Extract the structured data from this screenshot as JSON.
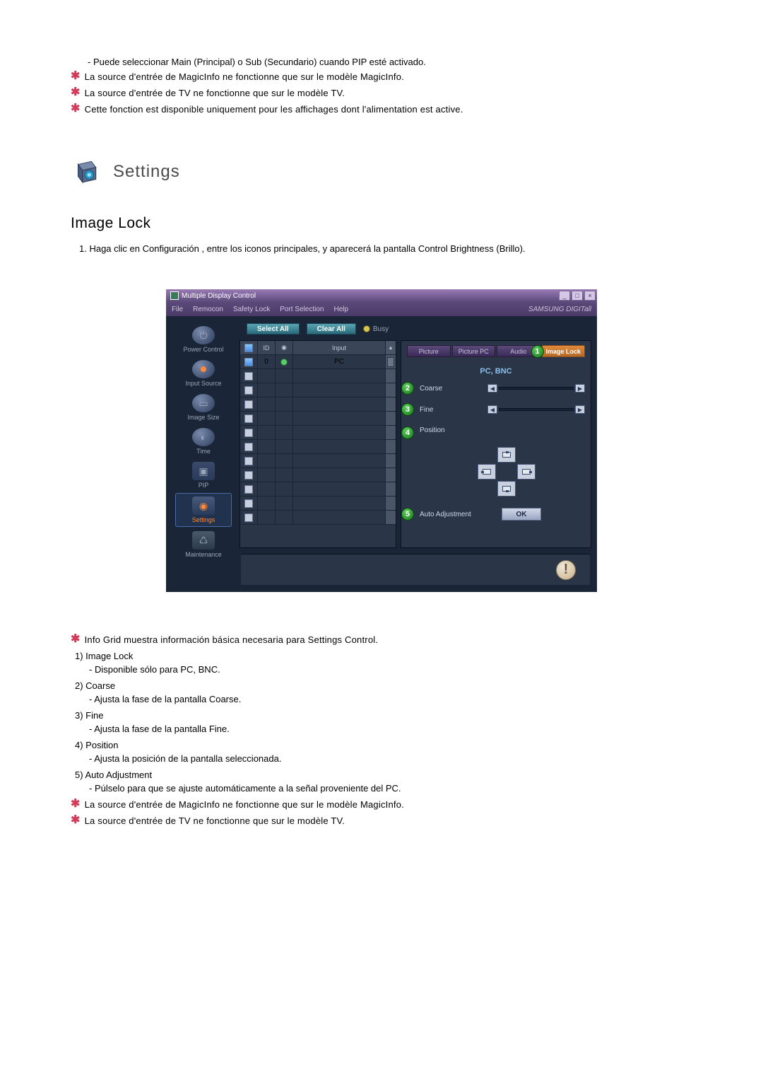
{
  "intro": {
    "dash_line": "- Puede seleccionar Main (Principal) o Sub (Secundario) cuando PIP esté activado.",
    "star1": "La source d'entrée de MagicInfo ne fonctionne que sur le modèle MagicInfo.",
    "star2": "La source d'entrée de TV ne fonctionne que sur le modèle TV.",
    "star3": "Cette fonction est disponible uniquement pour les affichages dont l'alimentation est active."
  },
  "section": {
    "title": "Settings",
    "subtitle": "Image Lock",
    "ol1": "1.  Haga clic en Configuración , entre los iconos principales, y aparecerá la pantalla Control Brightness (Brillo)."
  },
  "app": {
    "window_title": "Multiple Display Control",
    "menu": {
      "file": "File",
      "remocon": "Remocon",
      "safety": "Safety Lock",
      "port": "Port Selection",
      "help": "Help"
    },
    "brand": "SAMSUNG DIGITall",
    "win_buttons": {
      "min": "_",
      "max": "□",
      "close": "×"
    },
    "toolbar": {
      "select_all": "Select All",
      "clear_all": "Clear All",
      "busy": "Busy"
    },
    "sidebar": [
      {
        "label": "Power Control"
      },
      {
        "label": "Input Source"
      },
      {
        "label": "Image Size"
      },
      {
        "label": "Time"
      },
      {
        "label": "PIP"
      },
      {
        "label": "Settings"
      },
      {
        "label": "Maintenance"
      }
    ],
    "grid": {
      "h1": "☑",
      "h2": "ID",
      "h3": "●",
      "h4": "Input",
      "row1": {
        "id": "0",
        "input": "PC"
      }
    },
    "panel": {
      "tabs": {
        "picture": "Picture",
        "picture_pc": "Picture PC",
        "audio": "Audio",
        "image_lock": "Image Lock"
      },
      "mode": "PC, BNC",
      "coarse": "Coarse",
      "fine": "Fine",
      "position": "Position",
      "auto_adj": "Auto Adjustment",
      "ok": "OK",
      "bullets": {
        "b1": "1",
        "b2": "2",
        "b3": "3",
        "b4": "4",
        "b5": "5"
      }
    }
  },
  "desc": {
    "star_info": "Info Grid muestra información básica necesaria para Settings Control.",
    "i1_t": "1)  Image Lock",
    "i1_s": "- Disponible sólo para PC, BNC.",
    "i2_t": "2)  Coarse",
    "i2_s": "- Ajusta la fase de la pantalla Coarse.",
    "i3_t": "3)  Fine",
    "i3_s": "- Ajusta la fase de la pantalla Fine.",
    "i4_t": "4)  Position",
    "i4_s": "- Ajusta la posición de la pantalla seleccionada.",
    "i5_t": "5)  Auto Adjustment",
    "i5_s": "- Púlselo para que se ajuste automáticamente a la señal proveniente del PC.",
    "star_b1": "La source d'entrée de MagicInfo ne fonctionne que sur le modèle MagicInfo.",
    "star_b2": "La source d'entrée de TV ne fonctionne que sur le modèle TV."
  }
}
